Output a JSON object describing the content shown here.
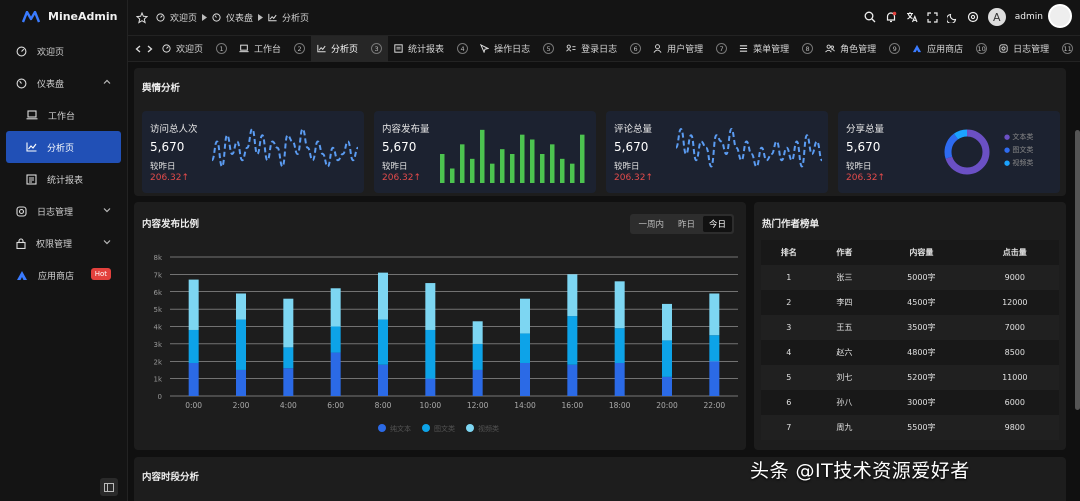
{
  "app": {
    "name": "MineAdmin"
  },
  "sidebar": {
    "items": [
      {
        "label": "欢迎页",
        "icon": "dashboard-icon"
      },
      {
        "label": "仪表盘",
        "icon": "gauge-icon"
      },
      {
        "label": "工作台",
        "icon": "laptop-icon"
      },
      {
        "label": "分析页",
        "icon": "line-chart-icon"
      },
      {
        "label": "统计报表",
        "icon": "report-icon"
      },
      {
        "label": "日志管理",
        "icon": "instagram-icon"
      },
      {
        "label": "权限管理",
        "icon": "lock-icon"
      },
      {
        "label": "应用商店",
        "icon": "store-logo-icon",
        "badge": "Hot"
      }
    ]
  },
  "header": {
    "breadcrumbs": [
      "欢迎页",
      "仪表盘",
      "分析页"
    ],
    "user": "admin",
    "avatar_letter": "A"
  },
  "tabs": [
    {
      "label": "欢迎页",
      "num": "1"
    },
    {
      "label": "工作台",
      "num": "2"
    },
    {
      "label": "分析页",
      "num": "3"
    },
    {
      "label": "统计报表",
      "num": "4"
    },
    {
      "label": "操作日志",
      "num": "5"
    },
    {
      "label": "登录日志",
      "num": "6"
    },
    {
      "label": "用户管理",
      "num": "7"
    },
    {
      "label": "菜单管理",
      "num": "8"
    },
    {
      "label": "角色管理",
      "num": "9"
    },
    {
      "label": "应用商店",
      "num": "10"
    },
    {
      "label": "日志管理",
      "num": "11"
    }
  ],
  "sentiment": {
    "title": "舆情分析",
    "cards": [
      {
        "title": "访问总人次",
        "value": "5,670",
        "compare": "较昨日",
        "delta": "206.32"
      },
      {
        "title": "内容发布量",
        "value": "5,670",
        "compare": "较昨日",
        "delta": "206.32"
      },
      {
        "title": "评论总量",
        "value": "5,670",
        "compare": "较昨日",
        "delta": "206.32"
      },
      {
        "title": "分享总量",
        "value": "5,670",
        "compare": "较昨日",
        "delta": "206.32"
      }
    ],
    "mini_bar_values": [
      3,
      1.5,
      4,
      2.5,
      5.5,
      2,
      3.5,
      3,
      5,
      4.5,
      3,
      4,
      2.5,
      2,
      5
    ],
    "mini_line_values": [
      3,
      6,
      2,
      7,
      4,
      6,
      3,
      5,
      8,
      4,
      7,
      3,
      6,
      5,
      2,
      7,
      6,
      4,
      8,
      5,
      3,
      6,
      4,
      2,
      5,
      3,
      4,
      6,
      3,
      5
    ],
    "donut": {
      "legend": [
        "文本类",
        "图文类",
        "视频类"
      ],
      "values": [
        70,
        20,
        10
      ],
      "colors": [
        "#6b50c4",
        "#2e6bf0",
        "#1ba3ff"
      ]
    }
  },
  "chart_data": {
    "type": "bar",
    "title": "内容发布比例",
    "stacked": true,
    "range_options": [
      "一周内",
      "昨日",
      "今日"
    ],
    "selected_range": "今日",
    "categories": [
      "0:00",
      "2:00",
      "4:00",
      "6:00",
      "8:00",
      "10:00",
      "12:00",
      "14:00",
      "16:00",
      "18:00",
      "20:00",
      "22:00"
    ],
    "series": [
      {
        "name": "纯文本",
        "color": "#2b6ae6",
        "values": [
          1900,
          1500,
          1600,
          2500,
          1800,
          1000,
          1500,
          1900,
          1800,
          1900,
          1100,
          2000
        ]
      },
      {
        "name": "图文类",
        "color": "#0da3e8",
        "values": [
          1900,
          2900,
          1200,
          1500,
          2600,
          2800,
          1500,
          1700,
          2800,
          2000,
          2100,
          1500
        ]
      },
      {
        "name": "视频类",
        "color": "#7dd6f2",
        "values": [
          2900,
          1500,
          2800,
          2200,
          2700,
          2700,
          1300,
          2000,
          2400,
          2700,
          2100,
          2400
        ]
      }
    ],
    "yticks": [
      "0",
      "1k",
      "2k",
      "3k",
      "4k",
      "5k",
      "6k",
      "7k",
      "8k"
    ],
    "ylim": [
      0,
      8000
    ],
    "grid": true,
    "legend_position": "bottom"
  },
  "authors": {
    "title": "热门作者榜单",
    "columns": [
      "排名",
      "作者",
      "内容量",
      "点击量"
    ],
    "rows": [
      [
        "1",
        "张三",
        "5000字",
        "9000"
      ],
      [
        "2",
        "李四",
        "4500字",
        "12000"
      ],
      [
        "3",
        "王五",
        "3500字",
        "7000"
      ],
      [
        "4",
        "赵六",
        "4800字",
        "8500"
      ],
      [
        "5",
        "刘七",
        "5200字",
        "11000"
      ],
      [
        "6",
        "孙八",
        "3000字",
        "6000"
      ],
      [
        "7",
        "周九",
        "5500字",
        "9800"
      ]
    ]
  },
  "timeslot": {
    "title": "内容时段分析"
  },
  "watermark": "头条 @IT技术资源爱好者",
  "colors": {
    "accent": "#2150b6",
    "up": "#e34b4b",
    "line": "#5b9cf2",
    "bar_green": "#4cc34f"
  }
}
